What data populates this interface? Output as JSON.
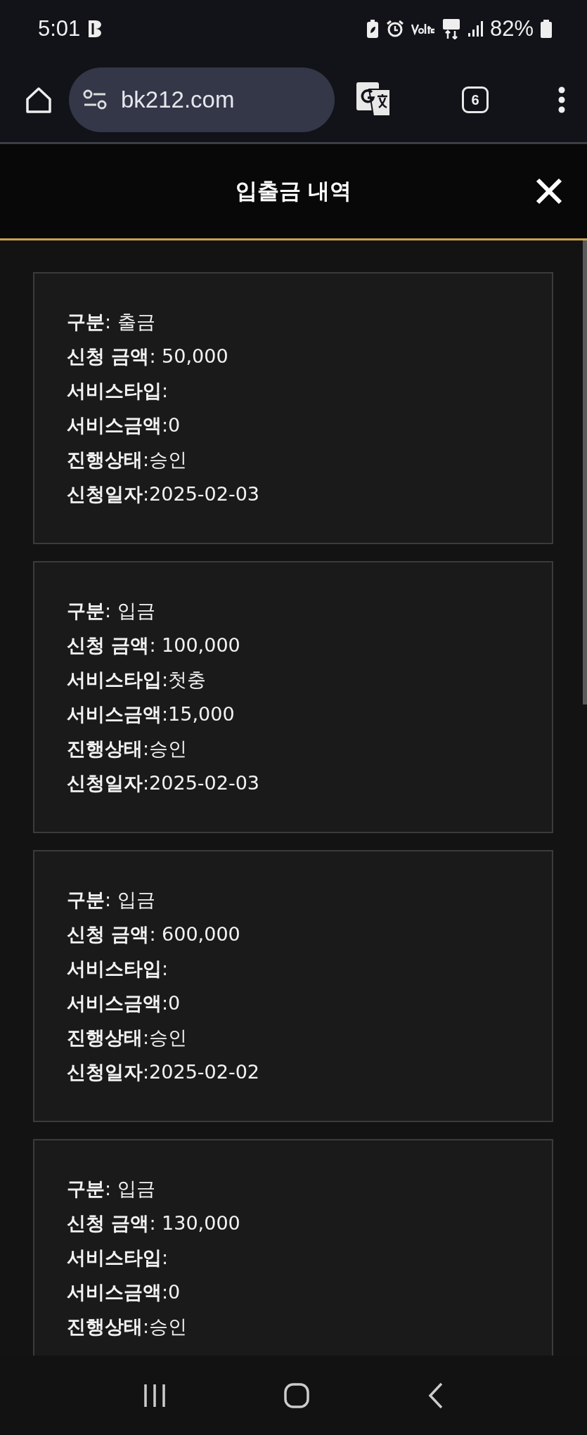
{
  "status_bar": {
    "time": "5:01",
    "battery": "82%"
  },
  "browser": {
    "url": "bk212.com",
    "tab_count": "6"
  },
  "header": {
    "title": "입출금 내역"
  },
  "cards": [
    {
      "rows": [
        {
          "label": "구분",
          "value": ": 출금"
        },
        {
          "label": "신청 금액",
          "value": ": 50,000"
        },
        {
          "label": "서비스타입",
          "value": ":"
        },
        {
          "label": "서비스금액",
          "value": ":0"
        },
        {
          "label": "진행상태",
          "value": ":승인"
        },
        {
          "label": "신청일자",
          "value": ":2025-02-03"
        }
      ]
    },
    {
      "rows": [
        {
          "label": "구분",
          "value": ": 입금"
        },
        {
          "label": "신청 금액",
          "value": ": 100,000"
        },
        {
          "label": "서비스타입",
          "value": ":첫충"
        },
        {
          "label": "서비스금액",
          "value": ":15,000"
        },
        {
          "label": "진행상태",
          "value": ":승인"
        },
        {
          "label": "신청일자",
          "value": ":2025-02-03"
        }
      ]
    },
    {
      "rows": [
        {
          "label": "구분",
          "value": ": 입금"
        },
        {
          "label": "신청 금액",
          "value": ": 600,000"
        },
        {
          "label": "서비스타입",
          "value": ":"
        },
        {
          "label": "서비스금액",
          "value": ":0"
        },
        {
          "label": "진행상태",
          "value": ":승인"
        },
        {
          "label": "신청일자",
          "value": ":2025-02-02"
        }
      ]
    },
    {
      "rows": [
        {
          "label": "구분",
          "value": ": 입금"
        },
        {
          "label": "신청 금액",
          "value": ": 130,000"
        },
        {
          "label": "서비스타입",
          "value": ":"
        },
        {
          "label": "서비스금액",
          "value": ":0"
        },
        {
          "label": "진행상태",
          "value": ":승인"
        }
      ]
    }
  ]
}
